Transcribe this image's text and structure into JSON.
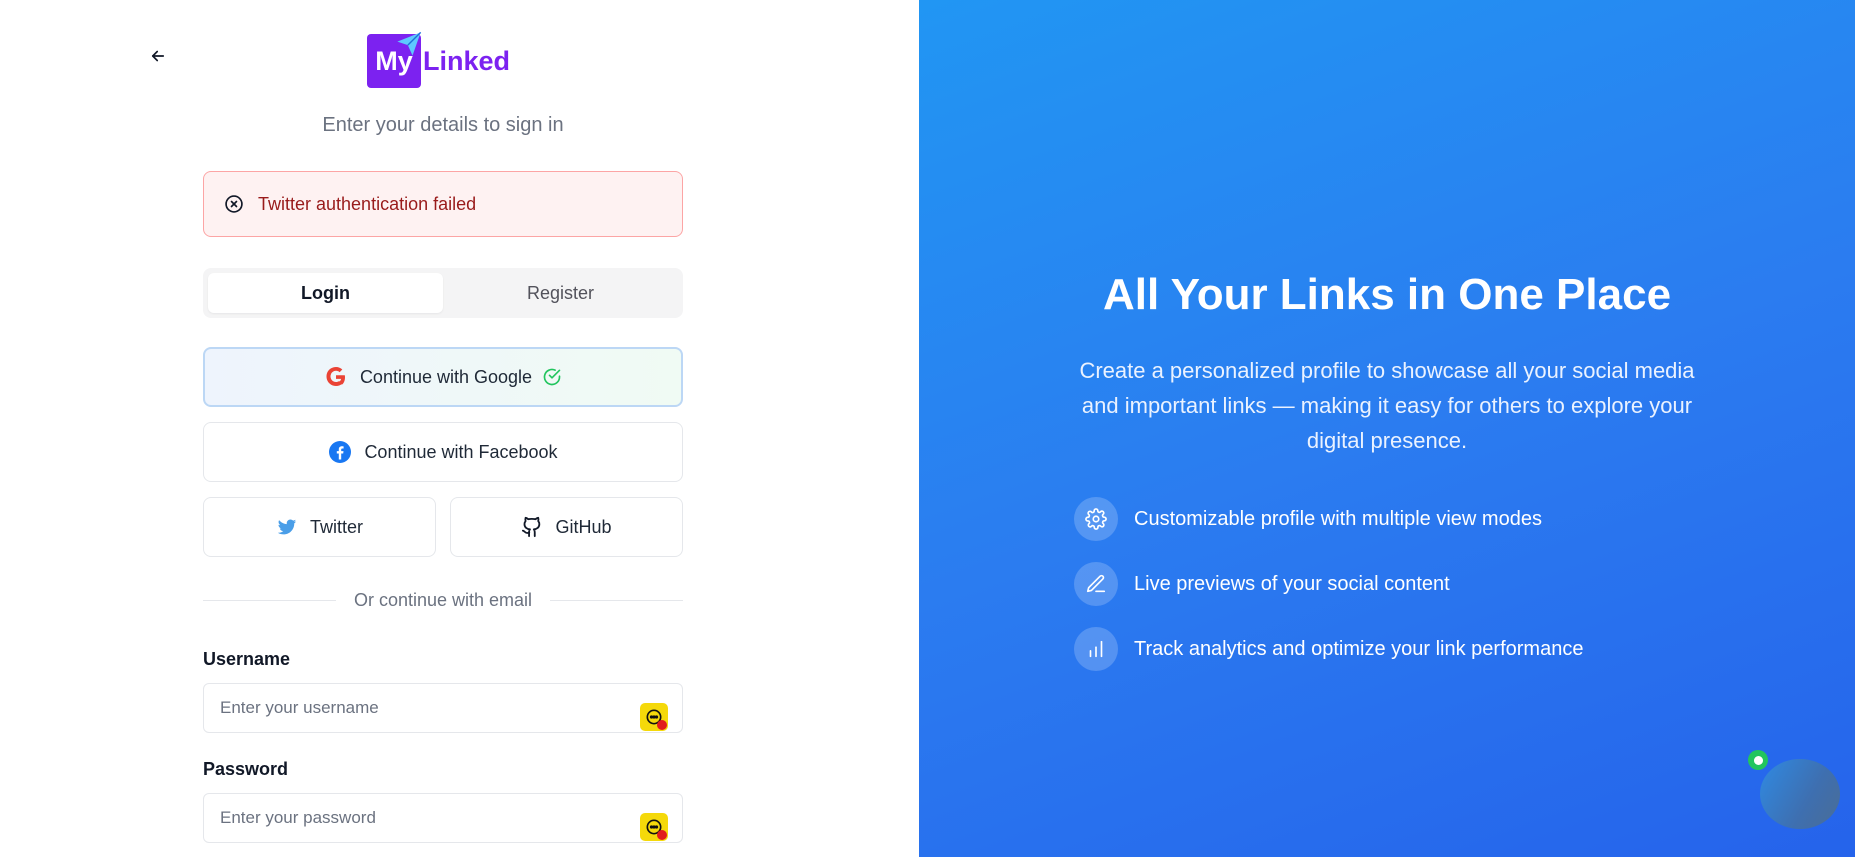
{
  "brand": {
    "logo_my": "My",
    "logo_linked": "Linked",
    "accent": "#7c22f0"
  },
  "auth": {
    "subtitle": "Enter your details to sign in",
    "error_message": "Twitter authentication failed",
    "tabs": [
      {
        "label": "Login",
        "active": true
      },
      {
        "label": "Register",
        "active": false
      }
    ],
    "oauth": {
      "google": "Continue with Google",
      "facebook": "Continue with Facebook",
      "twitter": "Twitter",
      "github": "GitHub"
    },
    "divider_text": "Or continue with email",
    "username": {
      "label": "Username",
      "placeholder": "Enter your username",
      "value": ""
    },
    "password": {
      "label": "Password",
      "placeholder": "Enter your password",
      "value": ""
    }
  },
  "hero": {
    "title": "All Your Links in One Place",
    "description": "Create a personalized profile to showcase all your social media and important links — making it easy for others to explore your digital presence.",
    "features": [
      {
        "icon": "gear-icon",
        "text": "Customizable profile with multiple view modes"
      },
      {
        "icon": "pen-icon",
        "text": "Live previews of your social content"
      },
      {
        "icon": "bar-chart-icon",
        "text": "Track analytics and optimize your link performance"
      }
    ]
  },
  "colors": {
    "hero_gradient_start": "#2196f3",
    "hero_gradient_end": "#2563eb",
    "error_bg": "#fef2f2",
    "error_text": "#991b1b",
    "success_check": "#22c55e"
  }
}
